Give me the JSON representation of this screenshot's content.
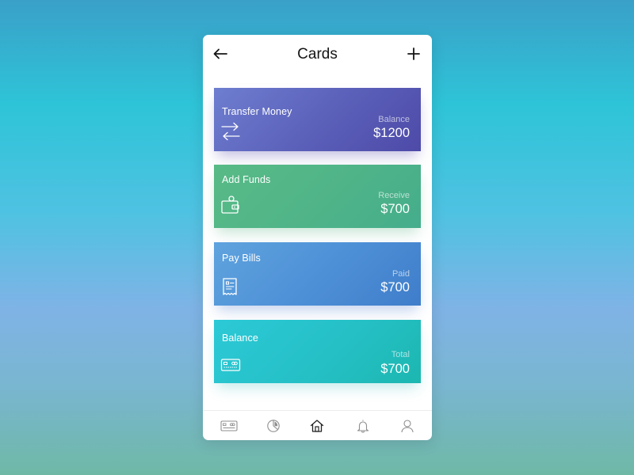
{
  "header": {
    "title": "Cards",
    "back_icon": "arrow-left-icon",
    "add_icon": "plus-icon"
  },
  "cards": [
    {
      "label": "Transfer Money",
      "caption": "Balance",
      "amount": "$1200",
      "icon": "transfer-arrows-icon",
      "color": "#5a5fb8"
    },
    {
      "label": "Add Funds",
      "caption": "Receive",
      "amount": "$700",
      "icon": "wallet-icon",
      "color": "#4fb488"
    },
    {
      "label": "Pay Bills",
      "caption": "Paid",
      "amount": "$700",
      "icon": "receipt-icon",
      "color": "#4d8fd6"
    },
    {
      "label": "Balance",
      "caption": "Total",
      "amount": "$700",
      "icon": "credit-card-icon",
      "color": "#25c0c6"
    }
  ],
  "tabbar": {
    "items": [
      {
        "icon": "credit-card-icon",
        "active": false
      },
      {
        "icon": "pie-chart-icon",
        "active": false
      },
      {
        "icon": "home-icon",
        "active": true
      },
      {
        "icon": "bell-icon",
        "active": false
      },
      {
        "icon": "user-icon",
        "active": false
      }
    ],
    "active_color": "#222222",
    "inactive_color": "#8e8e8e"
  }
}
